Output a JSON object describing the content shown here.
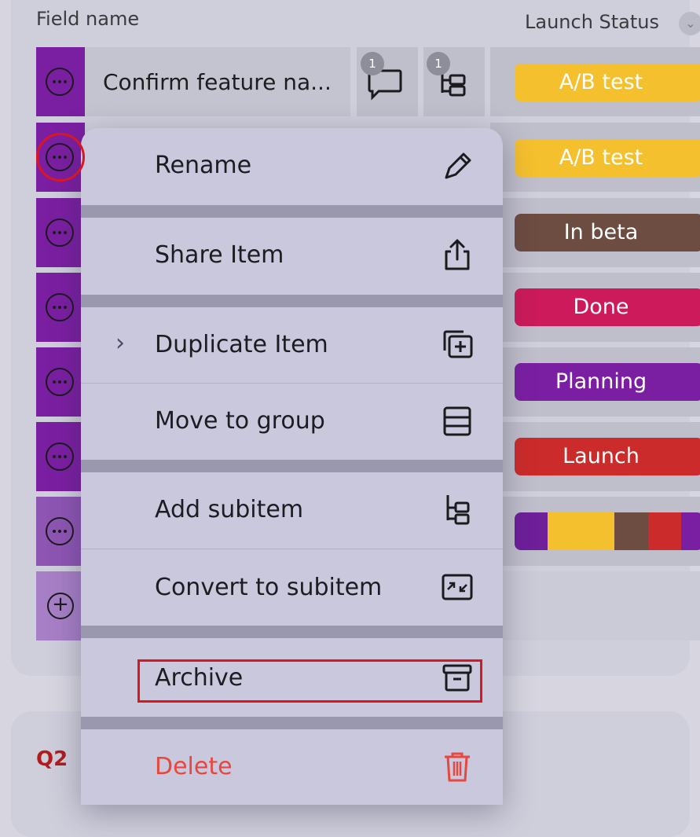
{
  "header": {
    "field_name": "Field name",
    "launch_status": "Launch Status",
    "chevron": "⌄"
  },
  "row1": {
    "name": "Confirm feature na...",
    "updates_count": "1",
    "subitems_count": "1"
  },
  "rows": [
    {
      "strip_color": "#7b1fa2",
      "status": "A/B test",
      "status_color": "#f5c02e"
    },
    {
      "strip_color": "#7b1fa2",
      "status": "A/B test",
      "status_color": "#f5c02e"
    },
    {
      "strip_color": "#7b1fa2",
      "status": "In beta",
      "status_color": "#6d4c41"
    },
    {
      "strip_color": "#7b1fa2",
      "status": "Done",
      "status_color": "#cc1a5a"
    },
    {
      "strip_color": "#7b1fa2",
      "status": "Planning",
      "status_color": "#7b1fa2"
    },
    {
      "strip_color": "#7b1fa2",
      "status": "Launch",
      "status_color": "#cc2b2b"
    },
    {
      "strip_color": "#8e55b3",
      "status": "",
      "status_color": ""
    }
  ],
  "summary_bar": [
    "#6e1f99",
    "#f5c02e",
    "#f5c02e",
    "#6d4c41",
    "#cc2b2b",
    "#7b1fa2"
  ],
  "menu": {
    "rename": "Rename",
    "share": "Share Item",
    "duplicate": "Duplicate Item",
    "duplicate_chevron": "›",
    "move": "Move to group",
    "add_subitem": "Add subitem",
    "convert": "Convert to subitem",
    "archive": "Archive",
    "delete": "Delete"
  },
  "icons": {
    "rename": "pencil-icon",
    "share": "share-icon",
    "duplicate": "duplicate-icon",
    "move": "group-icon",
    "add_subitem": "subitem-icon",
    "convert": "convert-icon",
    "archive": "archive-icon",
    "delete": "trash-icon"
  },
  "colors": {
    "delete": "#e8473f",
    "highlight": "#d8171f"
  },
  "group2": {
    "label": "Q2"
  }
}
